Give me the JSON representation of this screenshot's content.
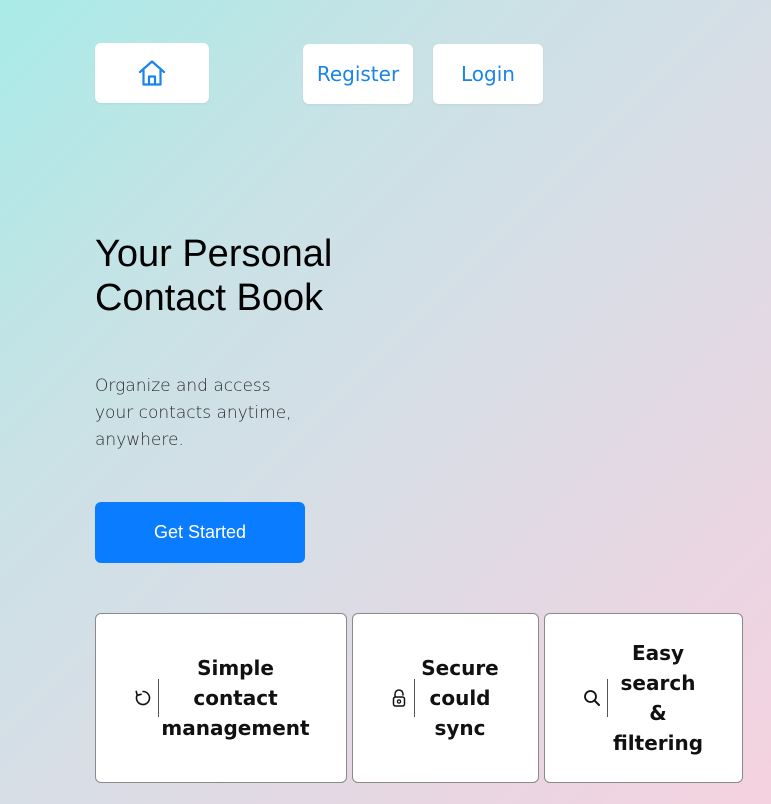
{
  "nav": {
    "home_icon": "home-icon",
    "register_label": "Register",
    "login_label": "Login"
  },
  "hero": {
    "title": "Your Personal Contact Book",
    "subtitle": "Organize and access your contacts anytime, anywhere.",
    "cta_label": "Get Started"
  },
  "features": [
    {
      "icon": "refresh-icon",
      "label": "Simple contact management"
    },
    {
      "icon": "lock-icon",
      "label": "Secure could sync"
    },
    {
      "icon": "search-icon",
      "label": "Easy search & filtering"
    }
  ],
  "colors": {
    "accent": "#0a7cff",
    "link": "#1a84e8",
    "gradient_start": "#a8ebe7",
    "gradient_end": "#f5d2e0"
  }
}
